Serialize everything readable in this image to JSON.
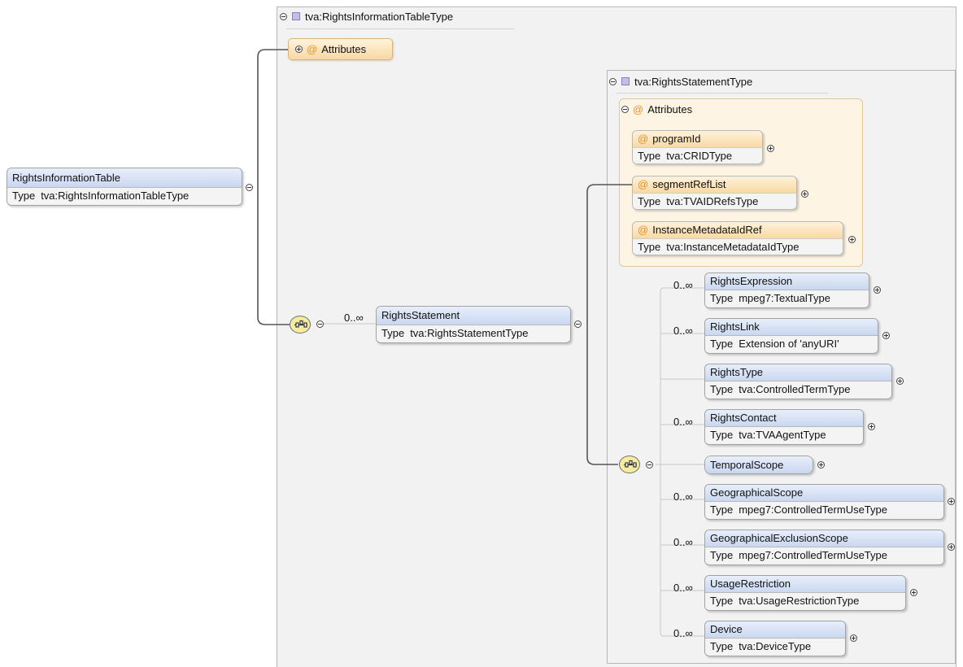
{
  "diagram": {
    "root": {
      "name": "RightsInformationTable",
      "type_key": "Type",
      "type_value": "tva:RightsInformationTableType"
    },
    "outer_type": {
      "title": "tva:RightsInformationTableType",
      "attributes_label": "Attributes"
    },
    "rights_statement": {
      "cardinality": "0..∞",
      "name": "RightsStatement",
      "type_key": "Type",
      "type_value": "tva:RightsStatementType"
    },
    "inner_type": {
      "title": "tva:RightsStatementType",
      "attributes_label": "Attributes",
      "attributes": [
        {
          "name": "programId",
          "type_key": "Type",
          "type_value": "tva:CRIDType"
        },
        {
          "name": "segmentRefList",
          "type_key": "Type",
          "type_value": "tva:TVAIDRefsType"
        },
        {
          "name": "InstanceMetadataIdRef",
          "type_key": "Type",
          "type_value": "tva:InstanceMetadataIdType"
        }
      ],
      "children": [
        {
          "cardinality": "0..∞",
          "name": "RightsExpression",
          "type_key": "Type",
          "type_value": "mpeg7:TextualType"
        },
        {
          "cardinality": "0..∞",
          "name": "RightsLink",
          "type_key": "Type",
          "type_value": "Extension of 'anyURI'"
        },
        {
          "cardinality": "",
          "name": "RightsType",
          "type_key": "Type",
          "type_value": "tva:ControlledTermType"
        },
        {
          "cardinality": "0..∞",
          "name": "RightsContact",
          "type_key": "Type",
          "type_value": "tva:TVAAgentType"
        },
        {
          "cardinality": "",
          "name": "TemporalScope",
          "type_key": "",
          "type_value": ""
        },
        {
          "cardinality": "0..∞",
          "name": "GeographicalScope",
          "type_key": "Type",
          "type_value": "mpeg7:ControlledTermUseType"
        },
        {
          "cardinality": "0..∞",
          "name": "GeographicalExclusionScope",
          "type_key": "Type",
          "type_value": "mpeg7:ControlledTermUseType"
        },
        {
          "cardinality": "0..∞",
          "name": "UsageRestriction",
          "type_key": "Type",
          "type_value": "tva:UsageRestrictionType"
        },
        {
          "cardinality": "0..∞",
          "name": "Device",
          "type_key": "Type",
          "type_value": "tva:DeviceType"
        }
      ]
    }
  }
}
